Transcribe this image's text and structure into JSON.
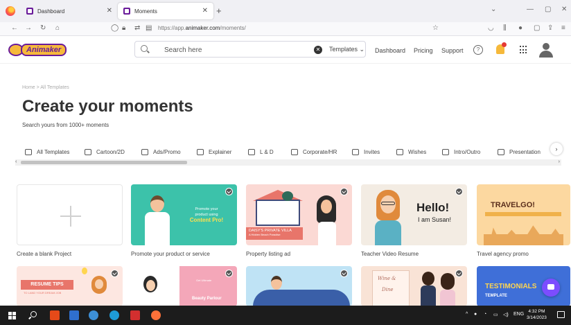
{
  "browser": {
    "tabs": [
      {
        "title": "Dashboard",
        "active": false
      },
      {
        "title": "Moments",
        "active": true
      }
    ],
    "new_tab_label": "+",
    "url_prefix": "https://app.",
    "url_domain": "animaker.com",
    "url_path": "/moments/"
  },
  "header": {
    "logo_text": "Animaker",
    "search_placeholder": "Search here",
    "search_scope": "Templates",
    "nav_links": [
      "Dashboard",
      "Pricing",
      "Support"
    ],
    "help_label": "?"
  },
  "hero": {
    "breadcrumb": "Home > All Templates",
    "title": "Create your moments",
    "subtitle": "Search yours from 1000+ moments"
  },
  "categories": [
    {
      "label": "All Templates",
      "icon": "all-templates-icon"
    },
    {
      "label": "Cartoon/2D",
      "icon": "cartoon-icon"
    },
    {
      "label": "Ads/Promo",
      "icon": "star-icon"
    },
    {
      "label": "Explainer",
      "icon": "explainer-icon"
    },
    {
      "label": "L & D",
      "icon": "graduation-icon"
    },
    {
      "label": "Corporate/HR",
      "icon": "briefcase-icon"
    },
    {
      "label": "Invites",
      "icon": "people-icon"
    },
    {
      "label": "Wishes",
      "icon": "card-icon"
    },
    {
      "label": "Intro/Outro",
      "icon": "instagram-icon"
    },
    {
      "label": "Presentation",
      "icon": "presentation-icon"
    }
  ],
  "templates_row1": [
    {
      "label": "Create a blank Project"
    },
    {
      "label": "Promote your product or service",
      "thumb_text": [
        "Promote your",
        "product using",
        "Content Pro!"
      ]
    },
    {
      "label": "Property listing ad",
      "thumb_text": [
        "DAISY'S PRIVATE VILLA",
        "A Hidden Beach Paradise"
      ]
    },
    {
      "label": "Teacher Video Resume",
      "thumb_text": [
        "Hello!",
        "I am Susan!"
      ]
    },
    {
      "label": "Travel agency promo",
      "thumb_text": [
        "TRAVELGO!"
      ]
    }
  ],
  "templates_row2": [
    {
      "thumb_text": [
        "RESUME TIPS",
        "TO LAND YOUR DREAM JOB"
      ]
    },
    {
      "thumb_text": [
        "Get Ultimate",
        "Beauty Parlour"
      ]
    },
    {
      "thumb_text": []
    },
    {
      "thumb_text": [
        "Wine &",
        "Dine"
      ]
    },
    {
      "thumb_text": [
        "TESTIMONIALS",
        "TEMPLATE"
      ]
    }
  ],
  "taskbar": {
    "language": "ENG",
    "time": "4:32 PM",
    "date": "3/14/2023"
  },
  "colors": {
    "brand_purple": "#6a1b9a",
    "brand_yellow": "#f6b93b",
    "chat_purple": "#7c4dff"
  }
}
